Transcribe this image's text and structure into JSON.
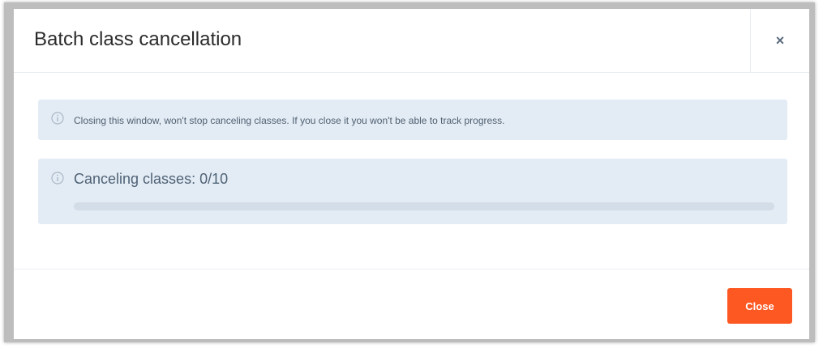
{
  "dialog": {
    "title": "Batch class cancellation",
    "close_icon_glyph": "×",
    "close_icon_name": "close-icon"
  },
  "info_alert": {
    "icon": "info-icon",
    "text": "Closing this window, won't stop canceling classes. If you close it you won't be able to track progress."
  },
  "progress_alert": {
    "icon": "info-icon",
    "title": "Canceling classes: 0/10",
    "completed": 0,
    "total": 10
  },
  "footer": {
    "close_label": "Close"
  },
  "colors": {
    "accent": "#fd5722",
    "alert_background": "#e3ecf5",
    "progress_track": "#d3dde8"
  }
}
